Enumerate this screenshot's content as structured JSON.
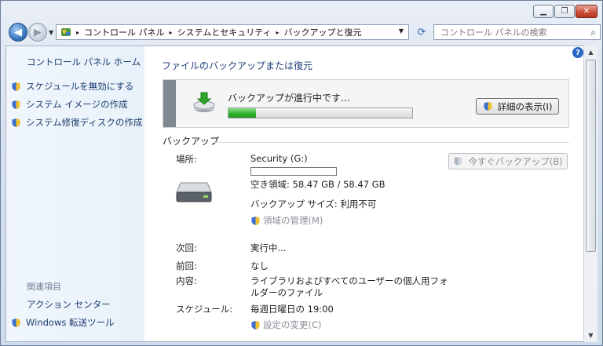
{
  "window_controls": {
    "minimize": "▁",
    "maximize": "❐",
    "close": "✕"
  },
  "nav": {
    "back": "◀",
    "forward": "▶",
    "dropdown": "▼"
  },
  "breadcrumb": [
    "コントロール パネル",
    "システムとセキュリティ",
    "バックアップと復元"
  ],
  "breadcrumb_sep": "▸",
  "address_dropdown": "▼",
  "refresh_icon": "⟳",
  "search": {
    "placeholder": "コントロール パネルの検索",
    "icon": "⌕"
  },
  "sidebar": {
    "home": "コントロール パネル ホーム",
    "tasks": [
      "スケジュールを無効にする",
      "システム イメージの作成",
      "システム修復ディスクの作成"
    ],
    "related_title": "関連項目",
    "related": [
      "アクション センター",
      "Windows 転送ツール"
    ]
  },
  "main": {
    "heading": "ファイルのバックアップまたは復元",
    "progress": {
      "status": "バックアップが進行中です...",
      "value_percent": 15
    },
    "details_button": "詳細の表示(I)",
    "section": "バックアップ",
    "location": {
      "label": "場所:",
      "drive": "Security (G:)",
      "free": "空き領域: 58.47 GB / 58.47 GB",
      "usage_percent": 0,
      "backup_size": "バックアップ サイズ: 利用不可",
      "manage": "領域の管理(M)"
    },
    "backup_now": "今すぐバックアップ(B)",
    "details": [
      {
        "label": "次回:",
        "value": "実行中..."
      },
      {
        "label": "前回:",
        "value": "なし"
      },
      {
        "label": "内容:",
        "value": "ライブラリおよびすべてのユーザーの個人用フォルダーのファイル"
      },
      {
        "label": "スケジュール:",
        "value": "毎週日曜日の 19:00"
      }
    ],
    "content_lines": [
      "ライブラリおよびすべてのユーザーの個人用フォ",
      "ルダーのファイル"
    ],
    "change_settings": "設定の変更(C)"
  },
  "help": "?",
  "scroll": {
    "up": "▲",
    "down": "▼"
  },
  "colors": {
    "accent": "#1b3d6e",
    "progress": "#2fb52b",
    "disabled": "#8a8f96"
  }
}
